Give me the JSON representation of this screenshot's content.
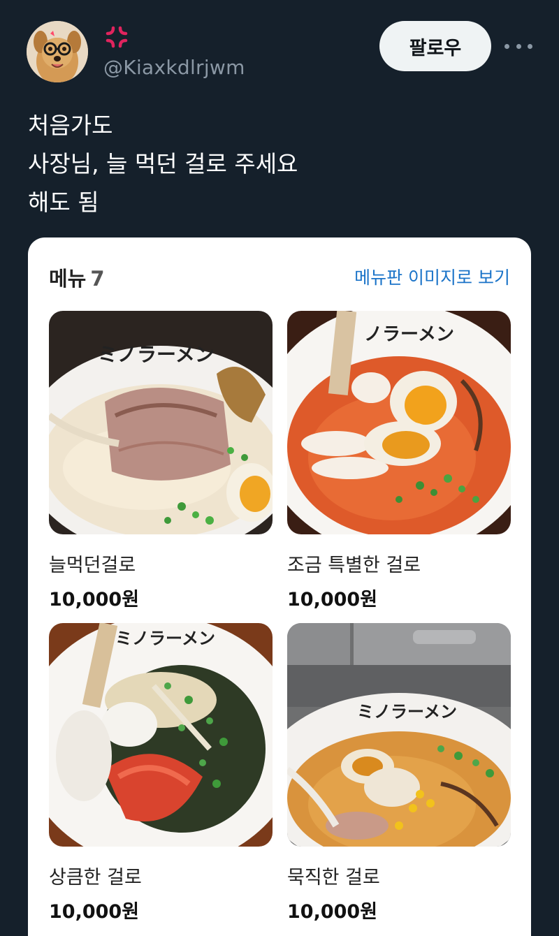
{
  "header": {
    "handle": "@Kiaxkdlrjwm",
    "follow_label": "팔로우",
    "avatar_icon": "dog-avatar",
    "emoji_icon": "anger-symbol-icon",
    "more_icon": "more-options-icon"
  },
  "tweet": {
    "lines": [
      "처음가도",
      "사장님, 늘 먹던 걸로 주세요",
      "해도 됨"
    ]
  },
  "menu": {
    "title": "메뉴",
    "count": "7",
    "view_board_label": "메뉴판 이미지로 보기",
    "items": [
      {
        "name": "늘먹던걸로",
        "price": "10,000원",
        "image": "tonkotsu-chashu-ramen"
      },
      {
        "name": "조금 특별한 걸로",
        "price": "10,000원",
        "image": "spicy-red-ramen"
      },
      {
        "name": "상큼한 걸로",
        "price": "10,000원",
        "image": "tomato-mazesoba"
      },
      {
        "name": "묵직한 걸로",
        "price": "10,000원",
        "image": "miso-ramen"
      }
    ],
    "bowl_logo_text": "ミノラーメン"
  },
  "colors": {
    "background": "#15202b",
    "link": "#1a73c8",
    "card": "#ffffff"
  }
}
